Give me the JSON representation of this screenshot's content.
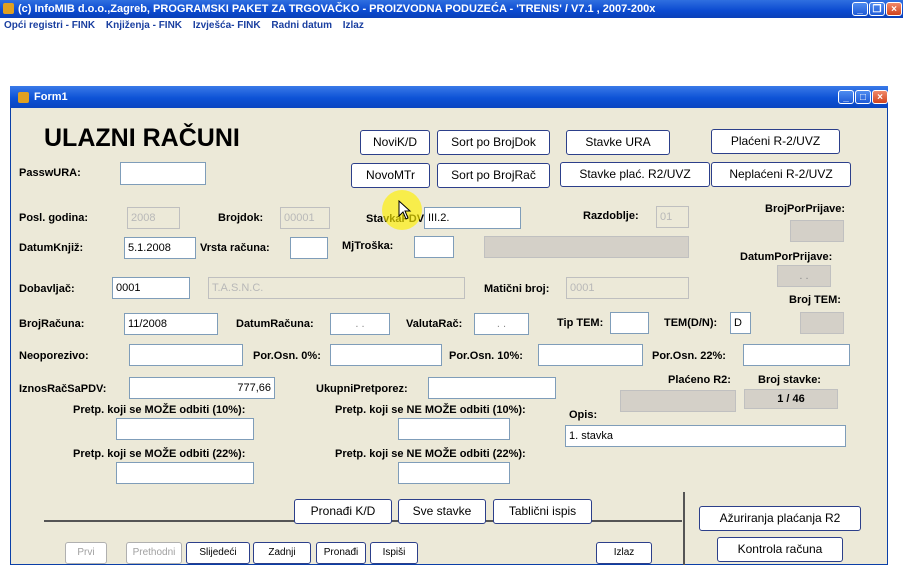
{
  "app": {
    "title": "(c) InfoMIB d.o.o.,Zagreb, PROGRAMSKI PAKET ZA TRGOVAČKO - PROIZVODNA PODUZEĆA - 'TRENIS' / V7.1 , 2007-200x",
    "menu": [
      "Opći registri - FINK",
      "Knjiženja - FINK",
      "Izvješća- FINK",
      "Radni datum",
      "Izlaz"
    ]
  },
  "form": {
    "title": "Form1",
    "heading": "ULAZNI RAČUNI",
    "buttons_top": {
      "novi_kd": "NoviK/D",
      "sort_brojdok": "Sort po BrojDok",
      "stavke_ura": "Stavke URA",
      "placeni": "Plaćeni R-2/UVZ",
      "novomtr": "NovoMTr",
      "sort_brojrac": "Sort po BrojRač",
      "stavke_plac": "Stavke plać. R2/UVZ",
      "neplaceni": "Neplaćeni R-2/UVZ"
    },
    "labels": {
      "passwura": "PasswURA:",
      "posl_godina": "Posl. godina:",
      "brojdok": "Brojdok:",
      "stavkapdv": "StavkaPDV:",
      "razdoblje": "Razdoblje:",
      "brojporprijave": "BrojPorPrijave:",
      "datumknjiz": "DatumKnjiž:",
      "vrsta_racuna": "Vrsta računa:",
      "mjtroska": "MjTroška:",
      "datumporprijave": "DatumPorPrijave:",
      "dobavljac": "Dobavljač:",
      "maticni_broj": "Matični broj:",
      "broj_tem": "Broj TEM:",
      "brojracuna": "BrojRačuna:",
      "datumracuna": "DatumRačuna:",
      "valutarac": "ValutaRač:",
      "tip_tem": "Tip TEM:",
      "tem_dn": "TEM(D/N):",
      "neoporezivo": "Neoporezivo:",
      "porosn0": "Por.Osn. 0%:",
      "porosn10": "Por.Osn. 10%:",
      "porosn22": "Por.Osn. 22%:",
      "iznos": "IznosRačSaPDV:",
      "ukupni_pretporez": "UkupniPretporez:",
      "placeno_r2": "Plaćeno R2:",
      "broj_stavke": "Broj stavke:",
      "pretp_moze_10": "Pretp. koji se MOŽE odbiti (10%):",
      "pretp_ne_moze_10": "Pretp. koji se NE MOŽE odbiti (10%):",
      "opis": "Opis:",
      "pretp_moze_22": "Pretp. koji se MOŽE odbiti (22%):",
      "pretp_ne_moze_22": "Pretp. koji se NE MOŽE odbiti (22%):"
    },
    "values": {
      "posl_godina": "2008",
      "brojdok": "00001",
      "stavkapdv": "III.2.",
      "razdoblje": "01",
      "datumknjiz": "5.1.2008",
      "dobavljac": "0001",
      "dobavljac_naziv": "T.A.S.N.C.",
      "maticni_broj": "0001",
      "brojracuna": "11/2008",
      "datumracuna": ". .",
      "valutarac": ". .",
      "tem_dn": "D",
      "iznos": "777,66",
      "broj_stavke": "1 / 46",
      "opis": "1. stavka",
      "datumporprijave": ". ."
    },
    "buttons_bottom": {
      "pronadi_kd": "Pronađi K/D",
      "sve_stavke": "Sve stavke",
      "tablicni_ispis": "Tablični ispis",
      "azuriranja": "Ažuriranja plaćanja R2",
      "kontrola": "Kontrola računa"
    },
    "nav": {
      "prvi": "Prvi",
      "prethodni": "Prethodni",
      "slijedeci": "Slijedeći",
      "zadnji": "Zadnji",
      "pronadi": "Pronađi",
      "ispisi": "Ispiši",
      "izlaz": "Izlaz"
    }
  }
}
